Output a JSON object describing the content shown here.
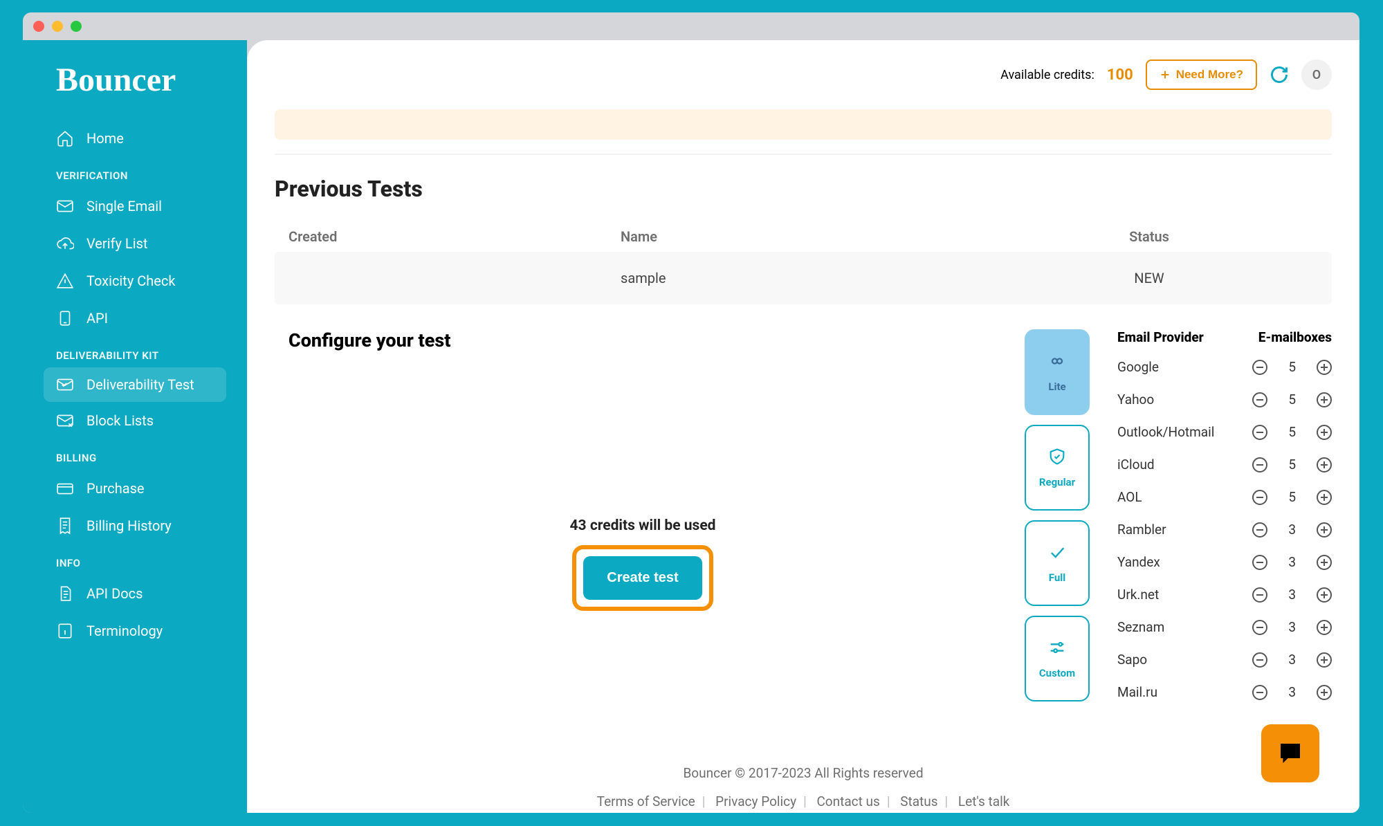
{
  "brand": "Bouncer",
  "sidebar": {
    "home": "Home",
    "sections": {
      "verification": "VERIFICATION",
      "deliverability": "DELIVERABILITY KIT",
      "billing": "BILLING",
      "info": "INFO"
    },
    "items": {
      "single_email": "Single Email",
      "verify_list": "Verify List",
      "toxicity": "Toxicity Check",
      "api": "API",
      "deliverability_test": "Deliverability Test",
      "block_lists": "Block Lists",
      "purchase": "Purchase",
      "billing_history": "Billing History",
      "api_docs": "API Docs",
      "terminology": "Terminology"
    }
  },
  "topbar": {
    "credits_label": "Available credits:",
    "credits_amount": "100",
    "need_more": "Need More?",
    "avatar_initial": "O"
  },
  "previous_tests": {
    "title": "Previous Tests",
    "th_created": "Created",
    "th_name": "Name",
    "th_status": "Status",
    "row": {
      "created": "",
      "name": "sample",
      "status": "NEW"
    }
  },
  "configure": {
    "title": "Configure your test",
    "credits_used": "43 credits will be used",
    "create_btn": "Create test",
    "tiers": {
      "lite": "Lite",
      "regular": "Regular",
      "full": "Full",
      "custom": "Custom"
    },
    "prov_header": {
      "col1": "Email Provider",
      "col2": "E-mailboxes"
    },
    "providers": [
      {
        "name": "Google",
        "count": "5"
      },
      {
        "name": "Yahoo",
        "count": "5"
      },
      {
        "name": "Outlook/Hotmail",
        "count": "5"
      },
      {
        "name": "iCloud",
        "count": "5"
      },
      {
        "name": "AOL",
        "count": "5"
      },
      {
        "name": "Rambler",
        "count": "3"
      },
      {
        "name": "Yandex",
        "count": "3"
      },
      {
        "name": "Urk.net",
        "count": "3"
      },
      {
        "name": "Seznam",
        "count": "3"
      },
      {
        "name": "Sapo",
        "count": "3"
      },
      {
        "name": "Mail.ru",
        "count": "3"
      }
    ]
  },
  "footer": {
    "copyright": "Bouncer © 2017-2023 All Rights reserved",
    "links": {
      "tos": "Terms of Service",
      "privacy": "Privacy Policy",
      "contact": "Contact us",
      "status": "Status",
      "talk": "Let's talk"
    }
  }
}
